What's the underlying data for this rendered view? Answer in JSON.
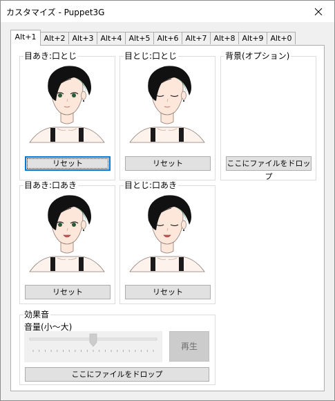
{
  "window": {
    "title": "カスタマイズ - Puppet3G"
  },
  "tabs": [
    "Alt+1",
    "Alt+2",
    "Alt+3",
    "Alt+4",
    "Alt+5",
    "Alt+6",
    "Alt+7",
    "Alt+8",
    "Alt+9",
    "Alt+0"
  ],
  "active_tab": "Alt+1",
  "panels": {
    "eyes_open_mouth_closed": {
      "label": "目あき:口とじ",
      "reset": "リセット"
    },
    "eyes_closed_mouth_closed": {
      "label": "目とじ:口とじ",
      "reset": "リセット"
    },
    "background": {
      "label": "背景(オプション)",
      "drop": "ここにファイルをドロップ"
    },
    "eyes_open_mouth_open": {
      "label": "目あき:口あき",
      "reset": "リセット"
    },
    "eyes_closed_mouth_open": {
      "label": "目とじ:口あき",
      "reset": "リセット"
    }
  },
  "sound": {
    "label": "効果音",
    "volume_label": "音量(小～大)",
    "volume_level": 0.5,
    "play": "再生",
    "drop": "ここにファイルをドロップ"
  },
  "icons": {
    "close": "close-icon"
  },
  "colors": {
    "focus": "#0078d7",
    "hair": "#111111",
    "hair_highlight": "#1f7a52",
    "eyes": "#2a5a3a",
    "skin": "#fde6da"
  }
}
